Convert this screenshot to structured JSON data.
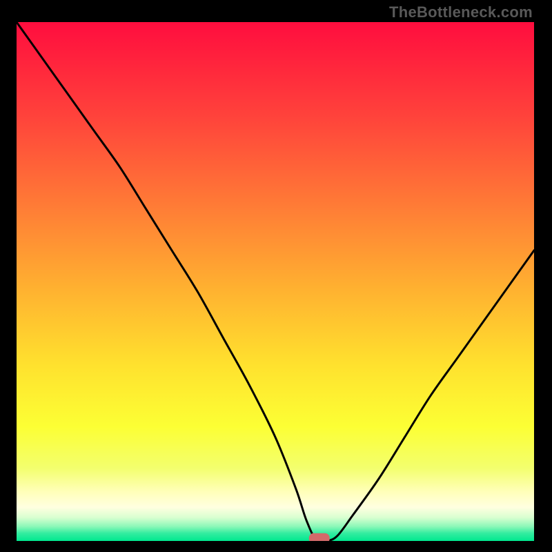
{
  "attribution": "TheBottleneck.com",
  "chart_data": {
    "type": "line",
    "title": "",
    "xlabel": "",
    "ylabel": "",
    "xlim": [
      0,
      100
    ],
    "ylim": [
      0,
      100
    ],
    "x": [
      0,
      5,
      10,
      15,
      20,
      25,
      30,
      35,
      40,
      45,
      50,
      54,
      56,
      58,
      60,
      62,
      65,
      70,
      75,
      80,
      85,
      90,
      95,
      100
    ],
    "values": [
      100,
      93,
      86,
      79,
      72,
      64,
      56,
      48,
      39,
      30,
      20,
      10,
      4,
      0,
      0,
      1,
      5,
      12,
      20,
      28,
      35,
      42,
      49,
      56
    ],
    "marker": {
      "x": 58.5,
      "y": 0.5,
      "shape": "rounded-rect",
      "color": "#d36a6a"
    },
    "background_gradient": {
      "stops": [
        {
          "pos": 0.0,
          "color": "#ff0d3e"
        },
        {
          "pos": 0.18,
          "color": "#ff423b"
        },
        {
          "pos": 0.35,
          "color": "#ff7a36"
        },
        {
          "pos": 0.52,
          "color": "#ffb330"
        },
        {
          "pos": 0.66,
          "color": "#ffe12e"
        },
        {
          "pos": 0.78,
          "color": "#fcff34"
        },
        {
          "pos": 0.86,
          "color": "#f3ff6e"
        },
        {
          "pos": 0.905,
          "color": "#ffffb9"
        },
        {
          "pos": 0.935,
          "color": "#ffffe0"
        },
        {
          "pos": 0.955,
          "color": "#d8ffd0"
        },
        {
          "pos": 0.972,
          "color": "#8cf8b8"
        },
        {
          "pos": 0.985,
          "color": "#34eda0"
        },
        {
          "pos": 1.0,
          "color": "#00e88f"
        }
      ]
    }
  }
}
